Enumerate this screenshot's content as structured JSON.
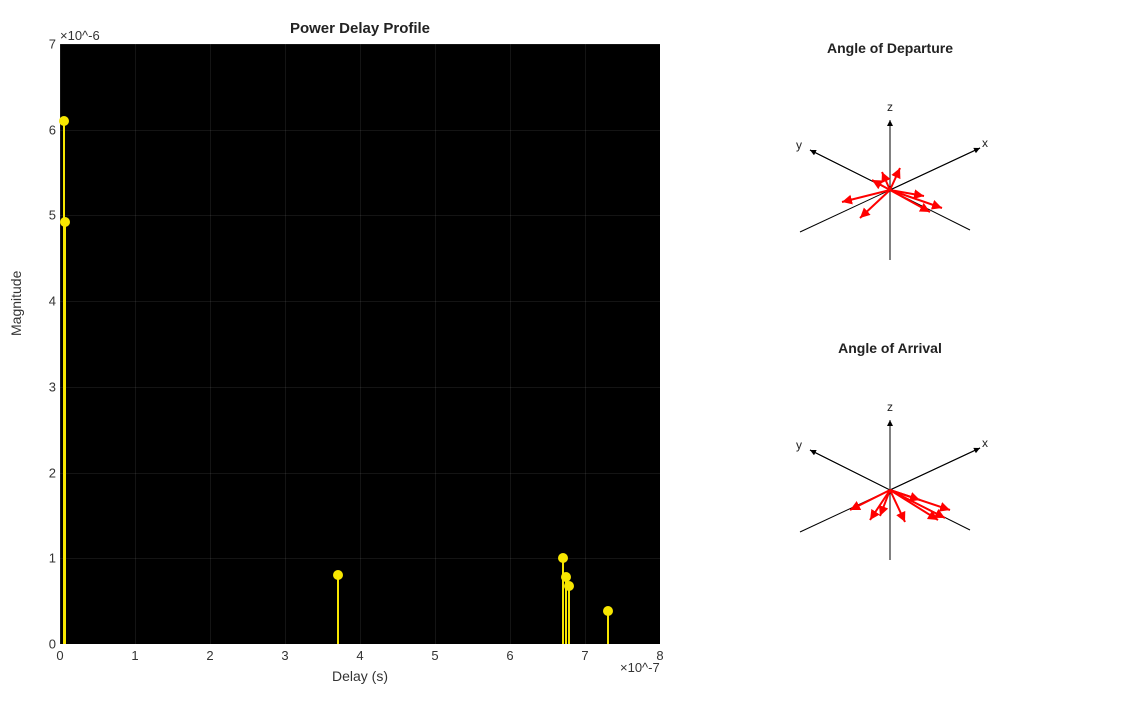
{
  "chart_data": [
    {
      "type": "stem",
      "title": "Power Delay Profile",
      "xlabel": "Delay (s)",
      "ylabel": "Magnitude",
      "x_exponent_label": "×10^-7",
      "y_exponent_label": "×10^-6",
      "xlim": [
        0,
        8
      ],
      "ylim": [
        0,
        7
      ],
      "x_ticks": [
        0,
        1,
        2,
        3,
        4,
        5,
        6,
        7,
        8
      ],
      "y_ticks": [
        0,
        1,
        2,
        3,
        4,
        5,
        6,
        7
      ],
      "points": [
        {
          "x_e7": 0.05,
          "y_e6": 6.1
        },
        {
          "x_e7": 0.07,
          "y_e6": 4.92
        },
        {
          "x_e7": 3.7,
          "y_e6": 0.8
        },
        {
          "x_e7": 6.7,
          "y_e6": 1.0
        },
        {
          "x_e7": 6.75,
          "y_e6": 0.78
        },
        {
          "x_e7": 6.78,
          "y_e6": 0.68
        },
        {
          "x_e7": 7.3,
          "y_e6": 0.38
        }
      ]
    },
    {
      "type": "quiver3d",
      "title": "Angle of Departure",
      "axis_labels": {
        "x": "x",
        "y": "y",
        "z": "z"
      },
      "vectors": [
        {
          "dx": 52,
          "dy": 18
        },
        {
          "dx": 40,
          "dy": 22
        },
        {
          "dx": -48,
          "dy": 12
        },
        {
          "dx": -30,
          "dy": 28
        },
        {
          "dx": 10,
          "dy": -22
        },
        {
          "dx": -8,
          "dy": -18
        },
        {
          "dx": 34,
          "dy": 6
        },
        {
          "dx": -18,
          "dy": -10
        }
      ]
    },
    {
      "type": "quiver3d",
      "title": "Angle of Arrival",
      "axis_labels": {
        "x": "x",
        "y": "y",
        "z": "z"
      },
      "vectors": [
        {
          "dx": 60,
          "dy": 20
        },
        {
          "dx": 55,
          "dy": 28
        },
        {
          "dx": 48,
          "dy": 30
        },
        {
          "dx": -40,
          "dy": 20
        },
        {
          "dx": -20,
          "dy": 30
        },
        {
          "dx": 15,
          "dy": 32
        },
        {
          "dx": 30,
          "dy": 10
        },
        {
          "dx": -10,
          "dy": 26
        }
      ]
    }
  ]
}
